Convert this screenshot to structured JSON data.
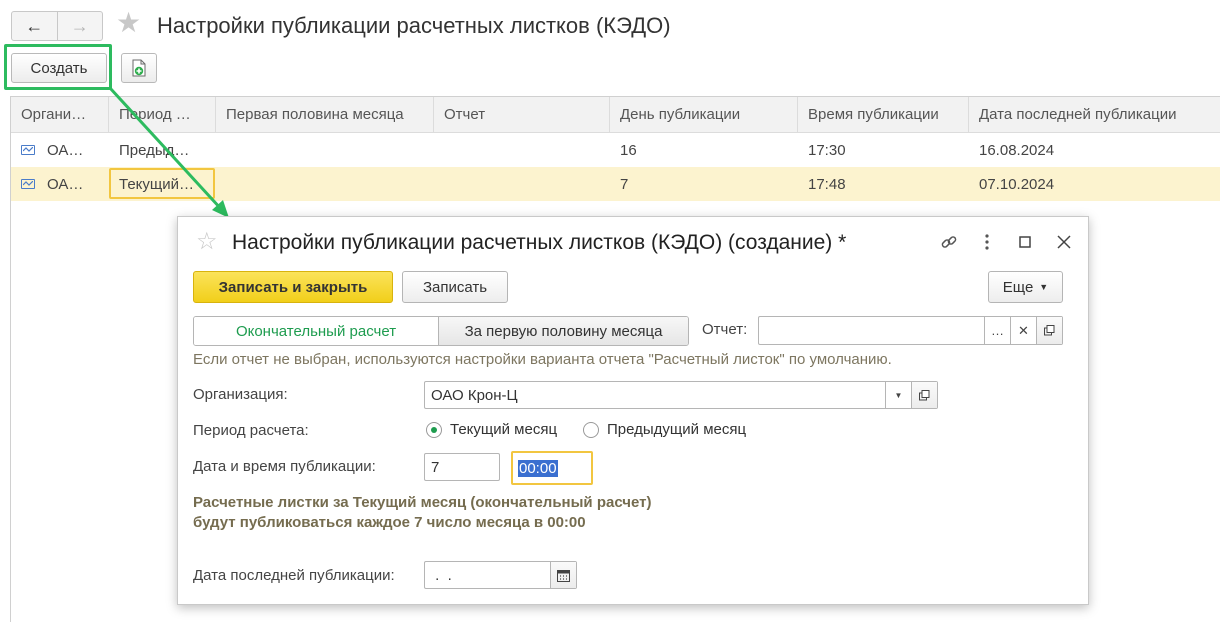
{
  "window": {
    "title": "Настройки публикации расчетных листков (КЭДО)",
    "back_icon": "←",
    "forward_icon": "→"
  },
  "toolbar": {
    "create_label": "Создать"
  },
  "table": {
    "columns": [
      "Органи…",
      "Период …",
      "Первая половина месяца",
      "Отчет",
      "День публикации",
      "Время публикации",
      "Дата последней публикации"
    ],
    "rows": [
      {
        "org": "ОА…",
        "period": "Предыд…",
        "first_half": "",
        "report": "",
        "day": "16",
        "time": "17:30",
        "last_date": "16.08.2024"
      },
      {
        "org": "ОА…",
        "period": "Текущий…",
        "first_half": "",
        "report": "",
        "day": "7",
        "time": "17:48",
        "last_date": "07.10.2024"
      }
    ]
  },
  "dialog": {
    "title": "Настройки публикации расчетных листков (КЭДО) (создание) *",
    "buttons": {
      "save_close": "Записать и закрыть",
      "save": "Записать",
      "more": "Еще"
    },
    "tabs": {
      "final": "Окончательный расчет",
      "first_half": "За первую половину месяца"
    },
    "report_label": "Отчет:",
    "report_value": "",
    "hint": "Если отчет не выбран, используются настройки варианта отчета \"Расчетный листок\" по умолчанию.",
    "org_label": "Организация:",
    "org_value": "ОАО Крон-Ц",
    "period_label": "Период расчета:",
    "period_current": "Текущий месяц",
    "period_previous": "Предыдущий месяц",
    "datetime_label": "Дата и время публикации:",
    "day_value": "7",
    "time_value": "00:00",
    "info": "Расчетные листки за Текущий месяц (окончательный расчет) будут публиковаться каждое 7 число месяца в 00:00",
    "last_date_label": "Дата последней публикации:",
    "last_date_value": " .  ."
  },
  "colors": {
    "accent_green": "#2dbb5f",
    "primary_yellow": "#f1cf1a",
    "selected_row": "#fcf3cf",
    "focus_border": "#f2c640"
  }
}
